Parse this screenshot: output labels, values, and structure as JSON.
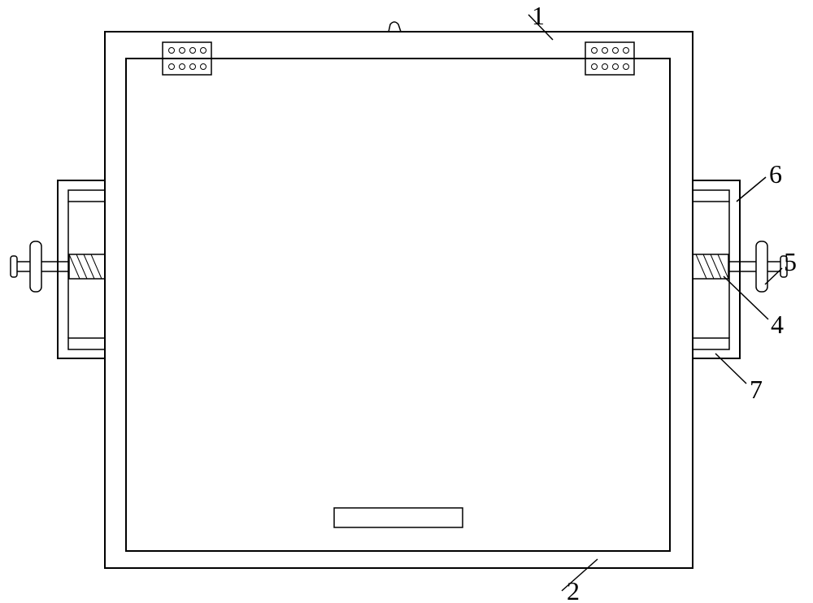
{
  "labels": {
    "l1": "1",
    "l2": "2",
    "l4": "4",
    "l5": "5",
    "l6": "6",
    "l7": "7"
  }
}
